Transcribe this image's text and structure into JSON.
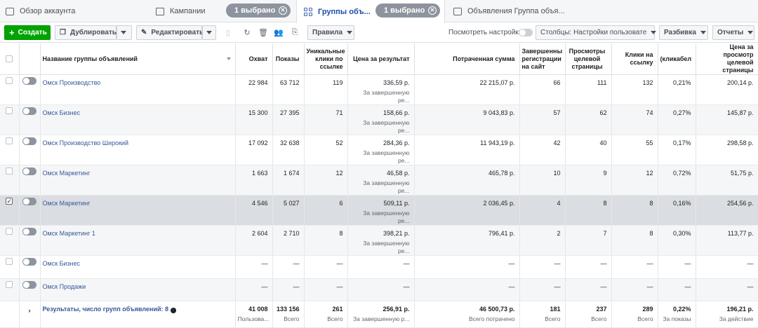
{
  "tabs": {
    "account": "Обзор аккаунта",
    "campaigns": "Кампании",
    "campaigns_badge": "1 выбрано",
    "adsets": "Группы объ...",
    "adsets_badge": "1 выбрано",
    "ads": "Объявления Группа объя..."
  },
  "toolbar": {
    "create": "Создать",
    "duplicate": "Дублировать",
    "edit": "Редактировать",
    "rules": "Правила",
    "view_settings": "Посмотреть настройки",
    "columns": "Столбцы: Настройки пользовате",
    "breakdown": "Разбивка",
    "reports": "Отчеты"
  },
  "columns": [
    "Название группы объявлений",
    "Охват",
    "Показы",
    "Уникальные клики по ссылке",
    "Цена за результат",
    "Потраченная сумма",
    "Завершенны регистрации на сайт",
    "Просмотры целевой страницы",
    "Клики на ссылку",
    "(кликабел",
    "Цена за просмотр целевой страницы"
  ],
  "rows": [
    {
      "name": "Омск Производство",
      "reach": "22 984",
      "impr": "63 712",
      "uclicks": "119",
      "cpr": "336,59 р.",
      "cpr_sub": "За завершенную ре...",
      "spent": "22 215,07 р.",
      "reg": "66",
      "lpv": "111",
      "clicks": "132",
      "ctr": "0,21%",
      "cplpv": "200,14 р."
    },
    {
      "name": "Омск Бизнес",
      "reach": "15 300",
      "impr": "27 395",
      "uclicks": "71",
      "cpr": "158,66 р.",
      "cpr_sub": "За завершенную ре...",
      "spent": "9 043,83 р.",
      "reg": "57",
      "lpv": "62",
      "clicks": "74",
      "ctr": "0,27%",
      "cplpv": "145,87 р."
    },
    {
      "name": "Омск Производство Широкий",
      "reach": "17 092",
      "impr": "32 638",
      "uclicks": "52",
      "cpr": "284,36 р.",
      "cpr_sub": "За завершенную ре...",
      "spent": "11 943,19 р.",
      "reg": "42",
      "lpv": "40",
      "clicks": "55",
      "ctr": "0,17%",
      "cplpv": "298,58 р."
    },
    {
      "name": "Омск Маркетинг",
      "reach": "1 663",
      "impr": "1 674",
      "uclicks": "12",
      "cpr": "46,58 р.",
      "cpr_sub": "За завершенную ре...",
      "spent": "465,78 р.",
      "reg": "10",
      "lpv": "9",
      "clicks": "12",
      "ctr": "0,72%",
      "cplpv": "51,75 р."
    },
    {
      "name": "Омск Маркетинг",
      "reach": "4 546",
      "impr": "5 027",
      "uclicks": "6",
      "cpr": "509,11 р.",
      "cpr_sub": "За завершенную ре...",
      "spent": "2 036,45 р.",
      "reg": "4",
      "lpv": "8",
      "clicks": "8",
      "ctr": "0,16%",
      "cplpv": "254,56 р."
    },
    {
      "name": "Омск Маркетинг 1",
      "reach": "2 604",
      "impr": "2 710",
      "uclicks": "8",
      "cpr": "398,21 р.",
      "cpr_sub": "За завершенную ре...",
      "spent": "796,41 р.",
      "reg": "2",
      "lpv": "7",
      "clicks": "8",
      "ctr": "0,30%",
      "cplpv": "113,77 р."
    },
    {
      "name": "Омск Бизнес",
      "reach": "—",
      "impr": "—",
      "uclicks": "—",
      "cpr": "—",
      "cpr_sub": "",
      "spent": "—",
      "reg": "—",
      "lpv": "—",
      "clicks": "—",
      "ctr": "—",
      "cplpv": "—"
    },
    {
      "name": "Омск Продажи",
      "reach": "—",
      "impr": "—",
      "uclicks": "—",
      "cpr": "—",
      "cpr_sub": "",
      "spent": "—",
      "reg": "—",
      "lpv": "—",
      "clicks": "—",
      "ctr": "—",
      "cplpv": "—"
    }
  ],
  "totals": {
    "label": "Результаты, число групп объявлений: 8",
    "reach": "41 008",
    "reach_sub": "Пользова...",
    "impr": "133 156",
    "impr_sub": "Всего",
    "uclicks": "261",
    "uclicks_sub": "Всего",
    "cpr": "256,91 р.",
    "cpr_sub": "За завершенную р...",
    "spent": "46 500,73 р.",
    "spent_sub": "Всего потрачено",
    "reg": "181",
    "reg_sub": "Всего",
    "lpv": "237",
    "lpv_sub": "Всего",
    "clicks": "289",
    "clicks_sub": "Всего",
    "ctr": "0,22%",
    "ctr_sub": "За показы",
    "cplpv": "196,21 р.",
    "cplpv_sub": "За действие"
  }
}
